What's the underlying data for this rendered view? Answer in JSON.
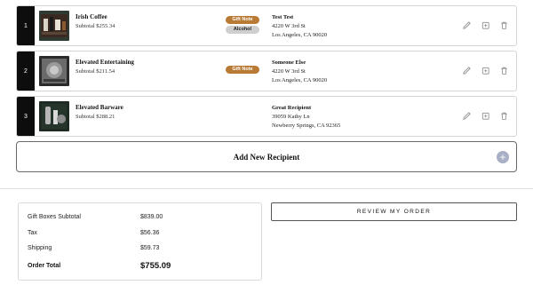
{
  "recipients": [
    {
      "index": "1",
      "product_name": "Irish Coffee",
      "subtotal": "Subtotal $255.34",
      "badges": [
        "Gift Note",
        "Alcohol"
      ],
      "recipient_name": "Test Test",
      "address_line1": "4220 W 3rd St",
      "address_line2": "Los Angeles, CA 90020"
    },
    {
      "index": "2",
      "product_name": "Elevated Entertaining",
      "subtotal": "Subtotal $211.54",
      "badges": [
        "Gift Note"
      ],
      "recipient_name": "Someone Else",
      "address_line1": "4220 W 3rd St",
      "address_line2": "Los Angeles, CA 90020"
    },
    {
      "index": "3",
      "product_name": "Elevated Barware",
      "subtotal": "Subtotal $288.21",
      "badges": [],
      "recipient_name": "Great Recipient",
      "address_line1": "39059 Kathy Ln",
      "address_line2": "Newberry Springs, CA 92365"
    }
  ],
  "add_recipient": {
    "label": "Add New Recipient"
  },
  "summary": {
    "gift_boxes_label": "Gift Boxes Subtotal",
    "gift_boxes_value": "$839.00",
    "tax_label": "Tax",
    "tax_value": "$56.36",
    "shipping_label": "Shipping",
    "shipping_value": "$59.73",
    "total_label": "Order Total",
    "total_value": "$755.09"
  },
  "review_button": {
    "label": "REVIEW MY ORDER"
  },
  "colors": {
    "gift_note_badge": "#b87a34",
    "alcohol_badge": "#cfcfcf",
    "index_bar": "#0d0d0d",
    "add_icon": "#a9b0c6"
  },
  "icons": [
    "edit-icon",
    "duplicate-icon",
    "trash-icon",
    "plus-icon"
  ]
}
